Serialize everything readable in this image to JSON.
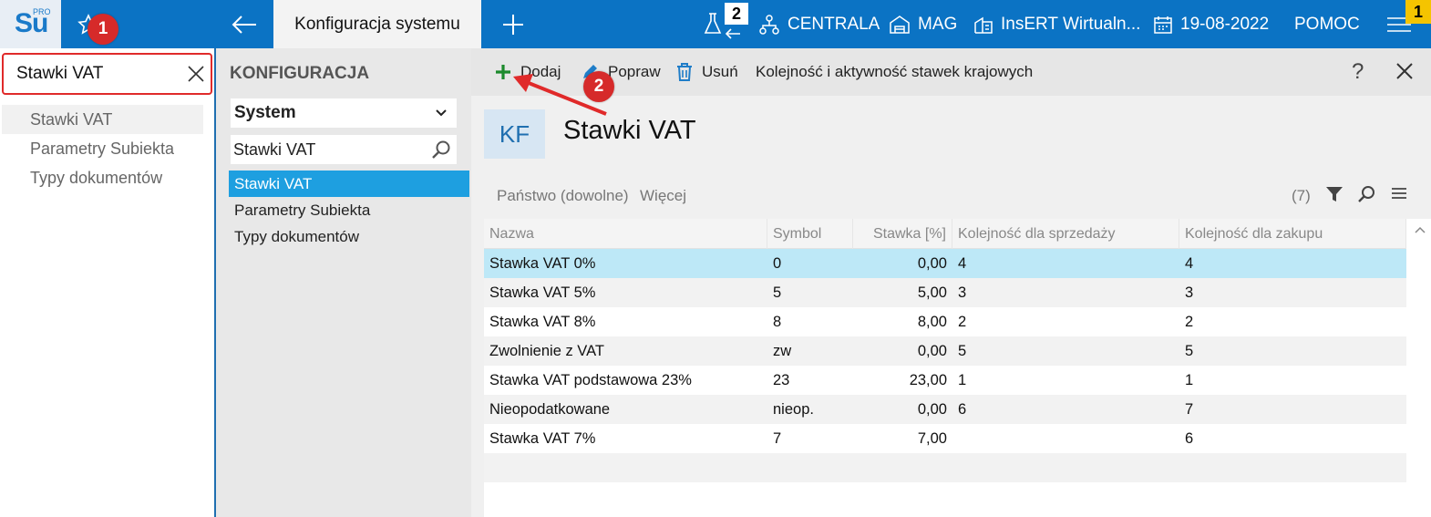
{
  "topbar": {
    "logo_text": "Su",
    "logo_sup": "PRO",
    "tab_title": "Konfiguracja systemu",
    "notif_count": "2",
    "centrala": "CENTRALA",
    "mag": "MAG",
    "company": "InsERT Wirtualn...",
    "date": "19-08-2022",
    "help": "POMOC",
    "corner_count": "1"
  },
  "left": {
    "search_value": "Stawki VAT",
    "items": [
      "Stawki VAT",
      "Parametry Subiekta",
      "Typy dokumentów"
    ]
  },
  "middle": {
    "title": "KONFIGURACJA",
    "select_value": "System",
    "search_value": "Stawki VAT",
    "items": [
      "Stawki VAT",
      "Parametry Subiekta",
      "Typy dokumentów"
    ]
  },
  "toolbar": {
    "add": "Dodaj",
    "edit": "Popraw",
    "delete": "Usuń",
    "order": "Kolejność i aktywność stawek krajowych",
    "help": "?"
  },
  "header": {
    "badge": "KF",
    "title": "Stawki VAT"
  },
  "filters": {
    "country": "Państwo (dowolne)",
    "more": "Więcej",
    "count": "(7)"
  },
  "grid": {
    "columns": [
      "Nazwa",
      "Symbol",
      "Stawka [%]",
      "Kolejność dla sprzedaży",
      "Kolejność dla zakupu"
    ],
    "rows": [
      [
        "Stawka VAT 0%",
        "0",
        "0,00",
        "4",
        "4"
      ],
      [
        "Stawka VAT 5%",
        "5",
        "5,00",
        "3",
        "3"
      ],
      [
        "Stawka VAT 8%",
        "8",
        "8,00",
        "2",
        "2"
      ],
      [
        "Zwolnienie z VAT",
        "zw",
        "0,00",
        "5",
        "5"
      ],
      [
        "Stawka VAT podstawowa 23%",
        "23",
        "23,00",
        "1",
        "1"
      ],
      [
        "Nieopodatkowane",
        "nieop.",
        "0,00",
        "6",
        "7"
      ],
      [
        "Stawka VAT 7%",
        "7",
        "7,00",
        "",
        "6"
      ]
    ]
  },
  "annotations": {
    "step1": "1",
    "step2": "2"
  },
  "colors": {
    "topbar": "#0b73c4",
    "selected_row": "#bde8f7",
    "selected_nav": "#1e9fe0",
    "annotation_red": "#d62a2a"
  }
}
